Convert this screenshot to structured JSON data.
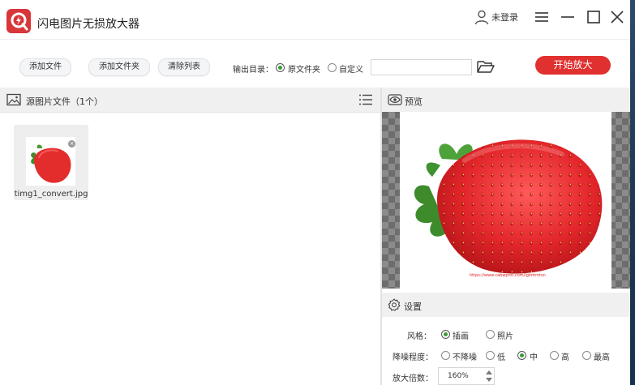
{
  "app": {
    "title": "闪电图片无损放大器",
    "login_label": "未登录",
    "brand_color": "#d9363a"
  },
  "toolbar": {
    "add_file": "添加文件",
    "add_folder": "添加文件夹",
    "clear_list": "清除列表",
    "output_dir_label": "输出目录：",
    "output_options": [
      {
        "label": "原文件夹",
        "selected": true
      },
      {
        "label": "自定义",
        "selected": false
      }
    ],
    "output_path": "",
    "start_button": "开始放大",
    "accent_color": "#e0302f"
  },
  "source_panel": {
    "title": "源图片文件（1个）",
    "files": [
      {
        "name": "timg1_convert.jpg"
      }
    ]
  },
  "preview_panel": {
    "title": "预览",
    "watermark": "https://www.cabwpmt.com/lglmtmtsn"
  },
  "settings_panel": {
    "title": "设置",
    "style_label": "风格：",
    "style_options": [
      {
        "label": "插画",
        "selected": true
      },
      {
        "label": "照片",
        "selected": false
      }
    ],
    "denoise_label": "降噪程度：",
    "denoise_options": [
      {
        "label": "不降噪",
        "selected": false
      },
      {
        "label": "低",
        "selected": false
      },
      {
        "label": "中",
        "selected": true
      },
      {
        "label": "高",
        "selected": false
      },
      {
        "label": "最高",
        "selected": false
      }
    ],
    "scale_label": "放大倍数：",
    "scale_value": "160%"
  },
  "icons": {
    "user": "user-icon",
    "menu": "menu-icon",
    "minimize": "minimize-icon",
    "maximize": "maximize-icon",
    "close": "close-icon",
    "folder": "folder-open-icon",
    "image": "image-icon",
    "list": "list-icon",
    "eye": "eye-icon",
    "gear": "gear-icon"
  }
}
